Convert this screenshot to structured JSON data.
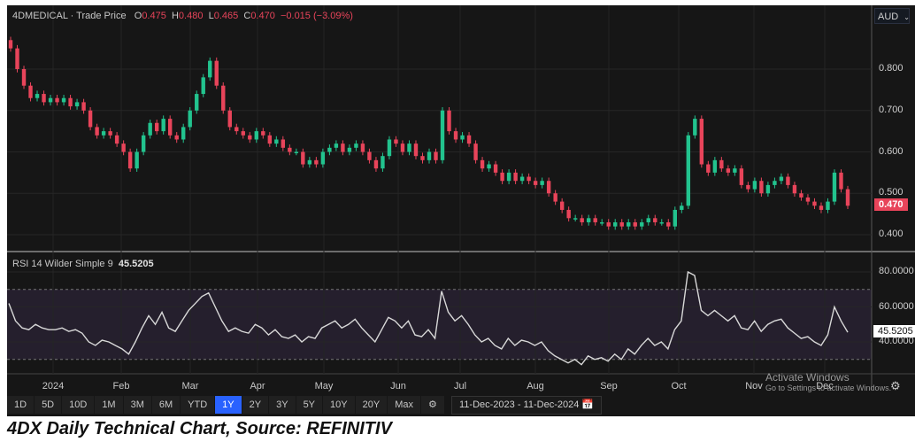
{
  "header": {
    "symbol": "4DMEDICAL · Trade Price",
    "o_label": "O",
    "o": "0.475",
    "h_label": "H",
    "h": "0.480",
    "l_label": "L",
    "l": "0.465",
    "c_label": "C",
    "c": "0.470",
    "change": "−0.015 (−3.09%)"
  },
  "currency": "AUD",
  "rsi_header": {
    "label": "RSI 14 Wilder Simple 9",
    "value": "45.5205"
  },
  "last_price_badge": "0.470",
  "rsi_badge": "45.5205",
  "toolbar": {
    "ranges": [
      "1D",
      "5D",
      "10D",
      "1M",
      "3M",
      "6M",
      "YTD",
      "1Y",
      "2Y",
      "3Y",
      "5Y",
      "10Y",
      "20Y",
      "Max"
    ],
    "active": "1Y",
    "date_range": "11-Dec-2023  -  11-Dec-2024"
  },
  "watermark": {
    "line1": "Activate Windows",
    "line2": "Go to Settings to activate Windows."
  },
  "caption": "4DX Daily Technical Chart, Source: REFINITIV",
  "colors": {
    "up": "#22c38e",
    "down": "#e8445a",
    "background": "#161616",
    "rsi_band": "#251f2d",
    "active": "#2962ff"
  },
  "chart_data": [
    {
      "type": "candlestick",
      "title": "4DMEDICAL · Trade Price",
      "ylabel": "AUD",
      "ylim": [
        0.35,
        0.87
      ],
      "yticks": [
        "0.800",
        "0.700",
        "0.600",
        "0.500",
        "0.400"
      ],
      "xticks": [
        "2024",
        "Feb",
        "Mar",
        "Apr",
        "May",
        "Jun",
        "Jul",
        "Aug",
        "Sep",
        "Oct",
        "Nov",
        "Dec"
      ],
      "close": [
        0.85,
        0.8,
        0.76,
        0.73,
        0.74,
        0.72,
        0.73,
        0.72,
        0.73,
        0.71,
        0.72,
        0.7,
        0.66,
        0.64,
        0.65,
        0.64,
        0.62,
        0.6,
        0.56,
        0.6,
        0.64,
        0.67,
        0.65,
        0.68,
        0.64,
        0.63,
        0.66,
        0.7,
        0.74,
        0.78,
        0.82,
        0.76,
        0.7,
        0.66,
        0.65,
        0.64,
        0.63,
        0.65,
        0.64,
        0.62,
        0.63,
        0.61,
        0.6,
        0.6,
        0.57,
        0.58,
        0.57,
        0.6,
        0.61,
        0.62,
        0.6,
        0.61,
        0.62,
        0.6,
        0.58,
        0.56,
        0.59,
        0.63,
        0.62,
        0.6,
        0.62,
        0.59,
        0.58,
        0.6,
        0.58,
        0.7,
        0.65,
        0.63,
        0.64,
        0.62,
        0.58,
        0.56,
        0.57,
        0.55,
        0.53,
        0.55,
        0.53,
        0.54,
        0.53,
        0.52,
        0.53,
        0.5,
        0.48,
        0.46,
        0.44,
        0.44,
        0.43,
        0.44,
        0.43,
        0.43,
        0.42,
        0.43,
        0.42,
        0.43,
        0.42,
        0.43,
        0.44,
        0.43,
        0.43,
        0.42,
        0.46,
        0.47,
        0.64,
        0.68,
        0.57,
        0.55,
        0.58,
        0.56,
        0.55,
        0.56,
        0.52,
        0.51,
        0.53,
        0.5,
        0.52,
        0.53,
        0.54,
        0.52,
        0.5,
        0.49,
        0.48,
        0.47,
        0.46,
        0.48,
        0.55,
        0.51,
        0.47
      ]
    },
    {
      "type": "line",
      "title": "RSI 14 Wilder Simple 9",
      "ylim": [
        22,
        90
      ],
      "yticks": [
        "80.0000",
        "60.0000",
        "40.0000"
      ],
      "band": [
        30,
        70
      ],
      "values": [
        62,
        52,
        48,
        47,
        50,
        48,
        47,
        47,
        48,
        46,
        47,
        45,
        40,
        38,
        41,
        40,
        38,
        36,
        33,
        40,
        48,
        55,
        50,
        57,
        48,
        46,
        52,
        58,
        62,
        66,
        68,
        60,
        52,
        46,
        48,
        46,
        45,
        50,
        48,
        44,
        47,
        43,
        42,
        44,
        40,
        43,
        42,
        48,
        50,
        52,
        48,
        50,
        53,
        48,
        44,
        40,
        47,
        54,
        52,
        48,
        52,
        44,
        43,
        47,
        42,
        69,
        57,
        52,
        55,
        50,
        44,
        40,
        42,
        38,
        36,
        42,
        38,
        41,
        40,
        38,
        40,
        35,
        32,
        30,
        28,
        30,
        27,
        32,
        30,
        31,
        29,
        33,
        30,
        36,
        33,
        38,
        42,
        38,
        40,
        36,
        47,
        52,
        80,
        78,
        58,
        55,
        58,
        55,
        52,
        55,
        48,
        47,
        52,
        46,
        50,
        52,
        53,
        48,
        45,
        42,
        43,
        40,
        38,
        44,
        60,
        52,
        45.52
      ]
    }
  ]
}
